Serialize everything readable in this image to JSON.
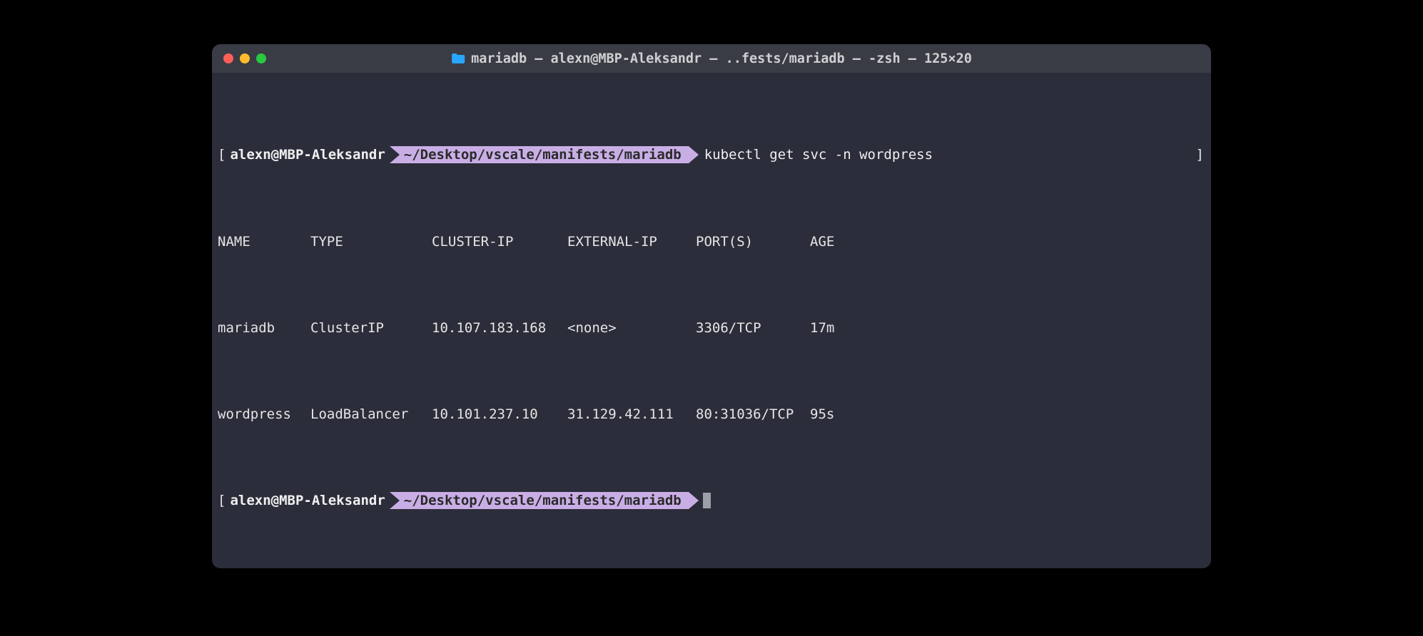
{
  "titlebar": {
    "title": "mariadb — alexn@MBP-Aleksandr — ..fests/mariadb — -zsh — 125×20"
  },
  "prompt1": {
    "bracket_open": "[",
    "userhost": "alexn@MBP-Aleksandr",
    "path": "~/Desktop/vscale/manifests/mariadb",
    "command": "kubectl get svc -n wordpress",
    "bracket_close": "]"
  },
  "headers": {
    "name": "NAME",
    "type": "TYPE",
    "cluster_ip": "CLUSTER-IP",
    "external_ip": "EXTERNAL-IP",
    "ports": "PORT(S)",
    "age": "AGE"
  },
  "rows": [
    {
      "name": "mariadb",
      "type": "ClusterIP",
      "cluster_ip": "10.107.183.168",
      "external_ip": "<none>",
      "ports": "3306/TCP",
      "age": "17m"
    },
    {
      "name": "wordpress",
      "type": "LoadBalancer",
      "cluster_ip": "10.101.237.10",
      "external_ip": "31.129.42.111",
      "ports": "80:31036/TCP",
      "age": "95s"
    }
  ],
  "prompt2": {
    "bracket_open": "[",
    "userhost": "alexn@MBP-Aleksandr",
    "path": "~/Desktop/vscale/manifests/mariadb"
  }
}
